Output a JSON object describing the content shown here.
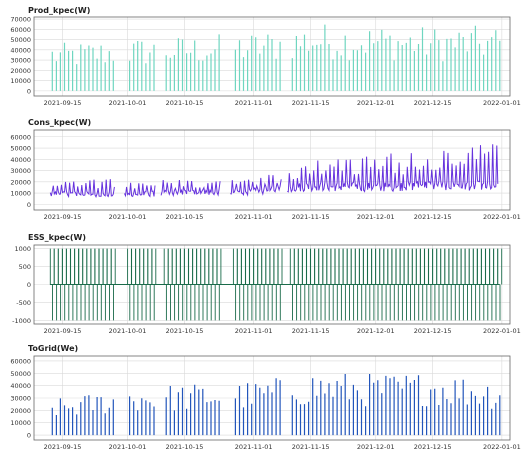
{
  "chart_data": [
    {
      "type": "line",
      "title": "Prod_kpec(W)",
      "color": "#6fd6c0",
      "x_range": [
        "2021-09-08",
        "2022-01-03"
      ],
      "x_ticks": [
        "2021-09-15",
        "2021-10-01",
        "2021-10-15",
        "2021-11-01",
        "2021-11-15",
        "2021-12-01",
        "2021-12-15",
        "2022-01-01"
      ],
      "y_ticks": [
        0,
        10000,
        20000,
        30000,
        40000,
        50000,
        60000,
        70000
      ],
      "ylim": [
        -5000,
        72000
      ],
      "grid": true,
      "gaps": [
        [
          "2021-09-28",
          "2021-09-30"
        ],
        [
          "2021-10-08",
          "2021-10-09"
        ],
        [
          "2021-10-24",
          "2021-10-26"
        ],
        [
          "2021-11-08",
          "2021-11-09"
        ]
      ],
      "data_start": "2021-09-12",
      "data_end": "2021-12-31",
      "series": [
        {
          "x": [
            "2021-09-15",
            "2021-10-01",
            "2021-10-15",
            "2021-11-01",
            "2021-11-15",
            "2021-12-01",
            "2021-12-15",
            "2021-12-31"
          ],
          "y_daily_peak": [
            47000,
            52000,
            54000,
            58000,
            67000,
            65000,
            63000,
            64000
          ]
        }
      ]
    },
    {
      "type": "line",
      "title": "Cons_kpec(W)",
      "color": "#6633dd",
      "x_range": [
        "2021-09-08",
        "2022-01-03"
      ],
      "x_ticks": [
        "2021-09-15",
        "2021-10-01",
        "2021-10-15",
        "2021-11-01",
        "2021-11-15",
        "2021-12-01",
        "2021-12-15",
        "2022-01-01"
      ],
      "y_ticks": [
        0,
        10000,
        20000,
        30000,
        40000,
        50000,
        60000
      ],
      "ylim": [
        -5000,
        66000
      ],
      "grid": true,
      "gaps": [
        [
          "2021-09-28",
          "2021-09-30"
        ],
        [
          "2021-10-08",
          "2021-10-09"
        ],
        [
          "2021-10-24",
          "2021-10-26"
        ],
        [
          "2021-11-08",
          "2021-11-09"
        ]
      ],
      "data_start": "2021-09-12",
      "data_end": "2021-12-31",
      "series": [
        {
          "x": [
            "2021-09-15",
            "2021-10-01",
            "2021-10-15",
            "2021-11-01",
            "2021-11-15",
            "2021-12-01",
            "2021-12-15",
            "2021-12-31"
          ],
          "y_base": [
            10000,
            9000,
            11000,
            12000,
            17000,
            16000,
            18000,
            17000
          ],
          "y_daily_peak": [
            24000,
            22000,
            22000,
            22000,
            40000,
            45000,
            50000,
            55000
          ]
        }
      ]
    },
    {
      "type": "line",
      "title": "ESS_kpec(W)",
      "color": "#1a6b4a",
      "x_range": [
        "2021-09-08",
        "2022-01-03"
      ],
      "x_ticks": [
        "2021-09-15",
        "2021-10-01",
        "2021-10-15",
        "2021-11-01",
        "2021-11-15",
        "2021-12-01",
        "2021-12-15",
        "2022-01-01"
      ],
      "y_ticks": [
        -1000,
        -500,
        0,
        500,
        1000
      ],
      "ylim": [
        -1100,
        1100
      ],
      "grid": true,
      "gaps": [
        [
          "2021-09-28",
          "2021-09-30"
        ],
        [
          "2021-10-08",
          "2021-10-09"
        ],
        [
          "2021-10-24",
          "2021-10-26"
        ],
        [
          "2021-11-08",
          "2021-11-09"
        ]
      ],
      "data_start": "2021-09-12",
      "data_end": "2021-12-31",
      "series": [
        {
          "levels": [
            1000,
            0,
            -1000
          ]
        }
      ]
    },
    {
      "type": "line",
      "title": "ToGrid(We)",
      "color": "#2255bb",
      "x_range": [
        "2021-09-08",
        "2022-01-03"
      ],
      "x_ticks": [
        "2021-09-15",
        "2021-10-01",
        "2021-10-15",
        "2021-11-01",
        "2021-11-15",
        "2021-12-01",
        "2021-12-15",
        "2022-01-01"
      ],
      "y_ticks": [
        0,
        10000,
        20000,
        30000,
        40000,
        50000,
        60000
      ],
      "ylim": [
        -4000,
        64000
      ],
      "grid": true,
      "gaps": [
        [
          "2021-09-28",
          "2021-09-30"
        ],
        [
          "2021-10-08",
          "2021-10-09"
        ],
        [
          "2021-10-24",
          "2021-10-26"
        ],
        [
          "2021-11-08",
          "2021-11-09"
        ]
      ],
      "data_start": "2021-09-12",
      "data_end": "2021-12-31",
      "series": [
        {
          "x": [
            "2021-09-15",
            "2021-10-01",
            "2021-10-15",
            "2021-11-01",
            "2021-11-15",
            "2021-12-01",
            "2021-12-15",
            "2021-12-31"
          ],
          "y_daily_peak": [
            30000,
            40000,
            42000,
            44000,
            52000,
            50000,
            52000,
            45000
          ]
        }
      ]
    }
  ]
}
